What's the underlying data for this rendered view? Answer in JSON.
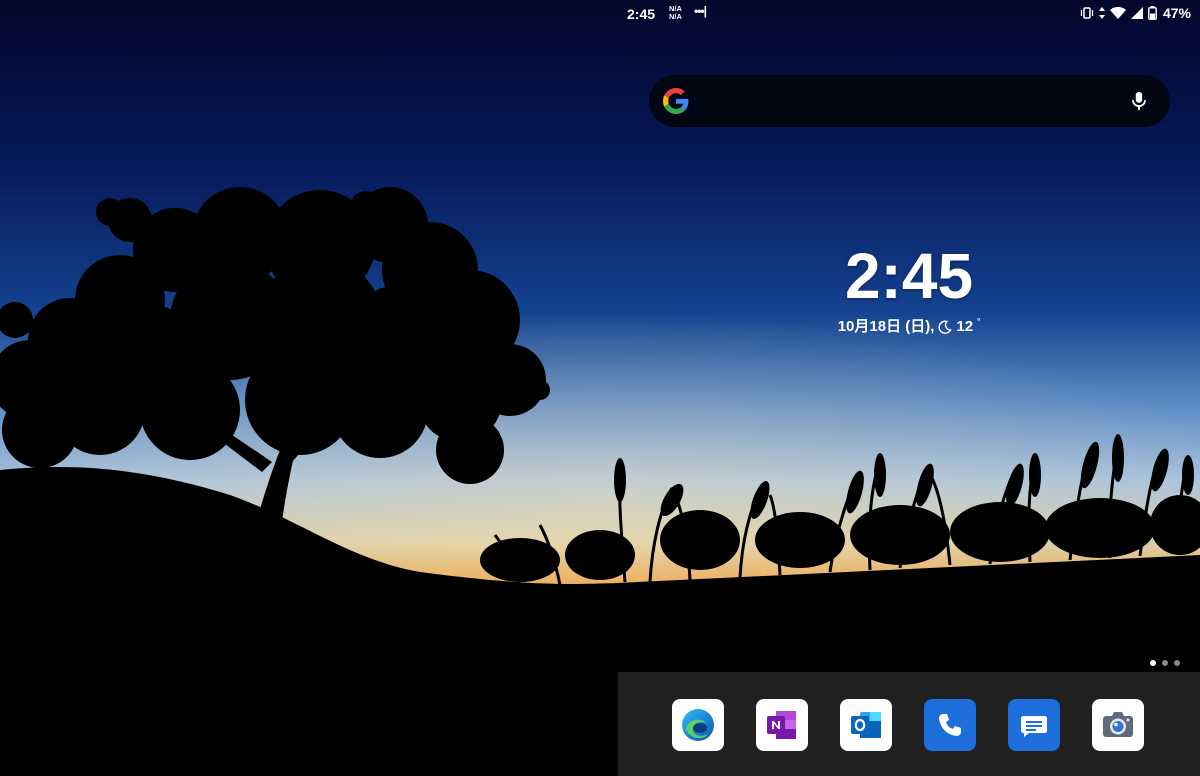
{
  "status_bar": {
    "time": "2:45",
    "network_line1": "N/A",
    "network_line2": "N/A",
    "more_dots": "•••|",
    "battery_percent": "47%",
    "icons": [
      "vibrate-icon",
      "data-arrows-icon",
      "wifi-icon",
      "signal-icon",
      "battery-icon"
    ]
  },
  "search": {
    "logo": "google-g-icon",
    "voice": "mic-icon"
  },
  "clock_widget": {
    "time": "2:45",
    "date": "10月18日 (日),",
    "weather_icon": "moon-icon",
    "temperature": "12",
    "degree": "°"
  },
  "page_indicator": {
    "pages": 3,
    "active": 0
  },
  "dock": {
    "apps": [
      {
        "name": "Microsoft Edge",
        "icon": "edge-icon"
      },
      {
        "name": "OneNote",
        "icon": "onenote-icon"
      },
      {
        "name": "Outlook",
        "icon": "outlook-icon"
      },
      {
        "name": "Phone",
        "icon": "phone-icon"
      },
      {
        "name": "Messages",
        "icon": "messages-icon"
      },
      {
        "name": "Camera",
        "icon": "camera-icon"
      }
    ]
  },
  "colors": {
    "sky_top": "#030a33",
    "sky_mid": "#11398a",
    "sky_horizon": "#e8a24e",
    "dock_bg": "#202020",
    "search_bg": "#020612",
    "app_blue": "#1e6fdc"
  }
}
